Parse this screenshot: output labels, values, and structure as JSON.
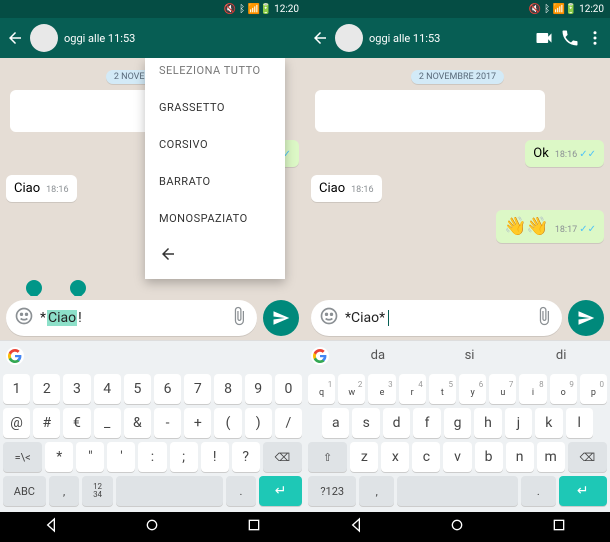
{
  "status": {
    "time": "12:20"
  },
  "header": {
    "subtitle": "oggi alle 11:53"
  },
  "chat": {
    "date_chip_partial": "2 NOVEMBRE 2017",
    "msg_ciao": "Ciao",
    "time_816": "18:16",
    "msg_ok": "Ok",
    "time_817": "18:17",
    "emoji": "👋👋"
  },
  "context_menu": {
    "cut_label": "SELEZIONA TUTTO",
    "items": [
      "GRASSETTO",
      "CORSIVO",
      "BARRATO",
      "MONOSPAZIATO"
    ]
  },
  "input": {
    "left_text_pre": "*",
    "left_text_sel": "Ciao",
    "left_text_post": "!",
    "right_text": "*Ciao*"
  },
  "suggestions": {
    "left": [
      "",
      "",
      ""
    ],
    "right": [
      "da",
      "si",
      "di"
    ]
  },
  "keyboard_left": {
    "row1": [
      "1",
      "2",
      "3",
      "4",
      "5",
      "6",
      "7",
      "8",
      "9",
      "0"
    ],
    "row2": [
      "@",
      "#",
      "€",
      "_",
      "&",
      "-",
      "+",
      "(",
      ")",
      "/"
    ],
    "row3_lead": "=\\<",
    "row3": [
      "*",
      "\"",
      "'",
      ":",
      ";",
      "!",
      "?"
    ],
    "row3_back": "⌫",
    "row4_abc": "ABC",
    "row4_comma": ",",
    "row4_frac": "1234",
    "row4_dot": ".",
    "row4_enter": "↵"
  },
  "keyboard_right": {
    "row1_letters": [
      "q",
      "w",
      "e",
      "r",
      "t",
      "y",
      "u",
      "i",
      "o",
      "p"
    ],
    "row1_nums": [
      "1",
      "2",
      "3",
      "4",
      "5",
      "6",
      "7",
      "8",
      "9",
      "0"
    ],
    "row2": [
      "a",
      "s",
      "d",
      "f",
      "g",
      "h",
      "j",
      "k",
      "l"
    ],
    "row3_shift": "⇧",
    "row3": [
      "z",
      "x",
      "c",
      "v",
      "b",
      "n",
      "m"
    ],
    "row3_back": "⌫",
    "row4_sym": "?123",
    "row4_comma": ",",
    "row4_dot": ".",
    "row4_enter": "↵"
  }
}
